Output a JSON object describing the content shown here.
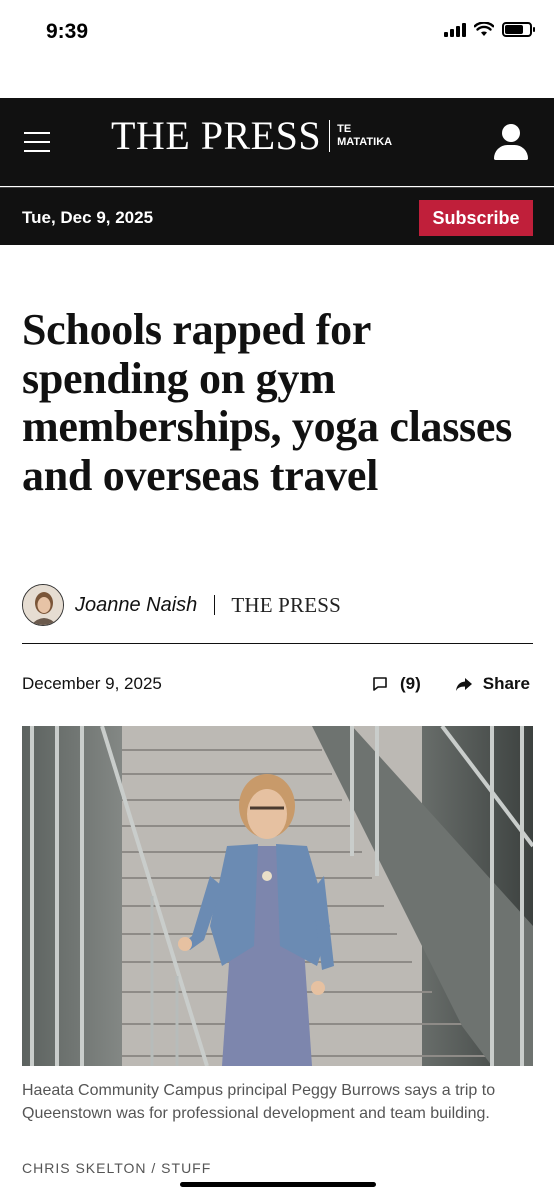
{
  "status_bar": {
    "time": "9:39",
    "battery_level": 0.75
  },
  "masthead": {
    "logo_main": "THE PRESS",
    "logo_sub_line1": "TE",
    "logo_sub_line2": "MATATIKA",
    "menu_icon": "hamburger-menu-icon",
    "account_icon": "user-account-icon",
    "background_color": "#111111"
  },
  "datebar": {
    "date": "Tue, Dec 9, 2025",
    "subscribe_label": "Subscribe",
    "accent_color": "#c01f3a"
  },
  "article": {
    "headline": "Schools rapped for spending on gym memberships, yoga classes and overseas travel",
    "author": "Joanne Naish",
    "publication": "THE PRESS",
    "date": "December 9, 2025",
    "comment_count": "(9)",
    "share_label": "Share",
    "caption": "Haeata Community Campus principal Peggy Burrows says a trip to Queenstown was for professional development and team building.",
    "photo_credit": "CHRIS SKELTON / STUFF"
  }
}
